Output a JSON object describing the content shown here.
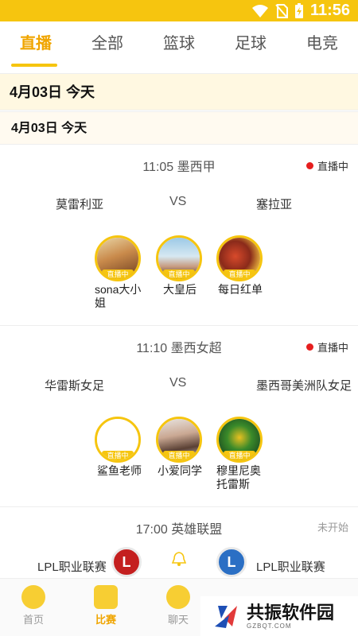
{
  "status_bar": {
    "time": "11:56",
    "colors": {
      "background": "#f6c50f"
    }
  },
  "tabs": [
    {
      "label": "直播",
      "active": true
    },
    {
      "label": "全部",
      "active": false
    },
    {
      "label": "篮球",
      "active": false
    },
    {
      "label": "足球",
      "active": false
    },
    {
      "label": "电竞",
      "active": false
    }
  ],
  "date_header": {
    "primary": "4月03日  今天",
    "secondary": "4月03日  今天"
  },
  "matches": [
    {
      "header": "11:05  墨西甲",
      "status": "直播中",
      "home": "莫雷利亚",
      "vs": "VS",
      "away": "塞拉亚",
      "hosts": [
        {
          "name": "sona大小姐",
          "tag": "直播中"
        },
        {
          "name": "大皇后",
          "tag": "直播中"
        },
        {
          "name": "每日红单",
          "tag": "直播中"
        }
      ]
    },
    {
      "header": "11:10  墨西女超",
      "status": "直播中",
      "home": "华雷斯女足",
      "vs": "VS",
      "away": "墨西哥美洲队女足",
      "hosts": [
        {
          "name": "鲨鱼老师",
          "tag": "直播中"
        },
        {
          "name": "小爱同学",
          "tag": "直播中"
        },
        {
          "name": "穆里尼奥托雷斯",
          "tag": "直播中"
        }
      ]
    },
    {
      "header": "17:00  英雄联盟",
      "status": "未开始",
      "home": "LPL职业联赛",
      "away": "LPL职业联赛",
      "home_badge": "L",
      "away_badge": "L"
    }
  ],
  "bottom_nav": [
    {
      "label": "首页",
      "icon": "home-icon",
      "active": false
    },
    {
      "label": "比赛",
      "icon": "match-icon",
      "active": true
    },
    {
      "label": "聊天",
      "icon": "chat-icon",
      "active": false
    }
  ],
  "watermark": {
    "title": "共振软件园",
    "subtitle": "GZBQT.COM"
  },
  "colors": {
    "accent": "#f6c50f",
    "active_text": "#f0a500",
    "live_dot": "#e61e1e"
  }
}
